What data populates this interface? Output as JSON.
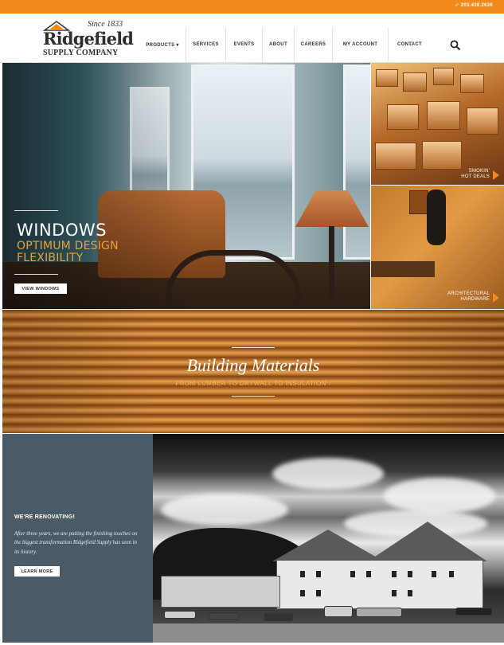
{
  "topbar": {
    "phone": "✓ 203.438.2626"
  },
  "logo": {
    "since": "Since 1833",
    "brand": "Ridgefield",
    "tagline": "SUPPLY COMPANY"
  },
  "nav": {
    "items": [
      {
        "label": "PRODUCTS ▾"
      },
      {
        "label": "SERVICES"
      },
      {
        "label": "EVENTS"
      },
      {
        "label": "ABOUT"
      },
      {
        "label": "CAREERS"
      },
      {
        "label": "MY ACCOUNT"
      },
      {
        "label": "CONTACT"
      }
    ],
    "search_icon": "search-icon"
  },
  "hero": {
    "title": "WINDOWS",
    "subtitle": "OPTIMUM DESIGN FLEXIBILITY",
    "button": "VIEW WINDOWS"
  },
  "tiles": {
    "deals": {
      "line1": "SMOKIN'",
      "line2": "HOT DEALS"
    },
    "hardware": {
      "line1": "ARCHITECTURAL",
      "line2": "HARDWARE"
    }
  },
  "building_materials": {
    "title": "Building Materials",
    "subtitle": "FROM LUMBER TO DRYWALL TO INSULATION ›"
  },
  "renovating": {
    "title": "WE'RE RENOVATING!",
    "text": "After three years, we are putting the finishing touches on the biggest transformation Ridgefield Supply has seen in its history.",
    "button": "LEARN MORE"
  },
  "colors": {
    "accent": "#f08a1c",
    "panel": "#4a5a67"
  }
}
